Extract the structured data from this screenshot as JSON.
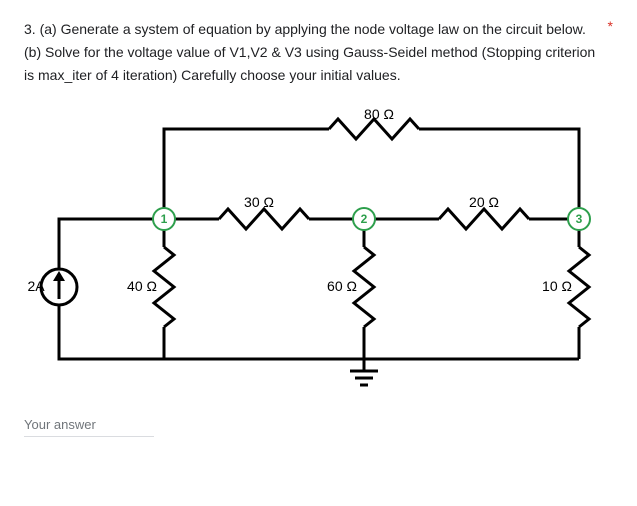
{
  "question": {
    "text": "3. (a) Generate a system of equation by applying the node voltage law on the circuit below. (b) Solve for the voltage value of V1,V2 & V3 using Gauss-Seidel method (Stopping criterion is max_iter of 4 iteration) Carefully choose your initial values.",
    "required_mark": "*"
  },
  "circuit": {
    "source": "2A",
    "r_top": "80 Ω",
    "r_12": "30 Ω",
    "r_23": "20 Ω",
    "r_1g": "40 Ω",
    "r_2g": "60 Ω",
    "r_3g": "10 Ω",
    "node1": "1",
    "node2": "2",
    "node3": "3"
  },
  "answer": {
    "placeholder": "Your answer"
  }
}
